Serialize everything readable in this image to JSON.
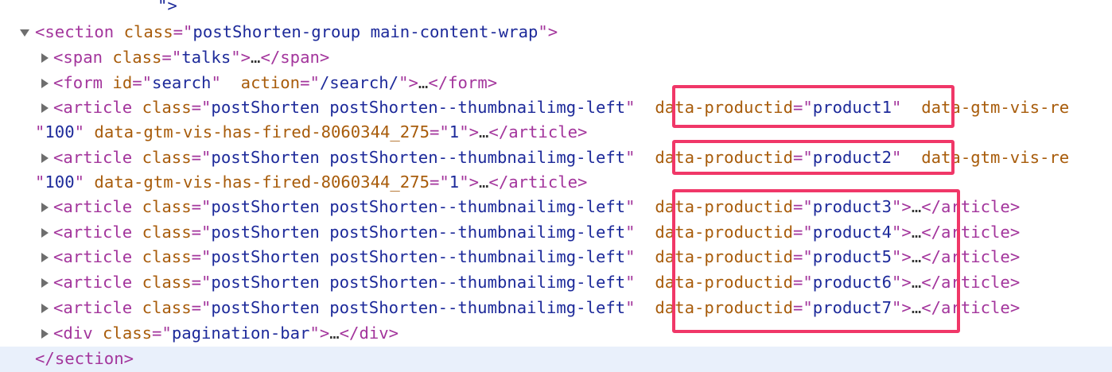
{
  "colors": {
    "tag": "#a3359c",
    "attribute": "#a85c0b",
    "value": "#1d2a9a",
    "highlight": "#f03768",
    "selected_row": "#e9f0fb"
  },
  "icons": {
    "expanded": "triangle-down-icon",
    "collapsed": "triangle-right-icon"
  },
  "tokens": {
    "lt": "<",
    "gt": ">",
    "lt_slash": "</",
    "eq": "=",
    "q": "\"",
    "ellipsis": "…"
  },
  "dom": {
    "top_fragment": "\">",
    "section": {
      "tag": "section",
      "class_attr": "class",
      "class_value": "postShorten-group main-content-wrap",
      "close": "section"
    },
    "span": {
      "tag": "span",
      "attr": "class",
      "value": "talks"
    },
    "form": {
      "tag": "form",
      "id_attr": "id",
      "id_value": "search",
      "action_attr": "action",
      "action_value": "/search/"
    },
    "article_tag": "article",
    "article_class_attr": "class",
    "article_class_value": "postShorten postShorten--thumbnailimg-left",
    "product_attr": "data-productid",
    "vis_attr_partial": "data-gtm-vis-re",
    "wrap_value": "100",
    "fired_attr": "data-gtm-vis-has-fired-8060344_275",
    "fired_value": "1",
    "articles": [
      {
        "productid": "product1"
      },
      {
        "productid": "product2"
      },
      {
        "productid": "product3"
      },
      {
        "productid": "product4"
      },
      {
        "productid": "product5"
      },
      {
        "productid": "product6"
      },
      {
        "productid": "product7"
      }
    ],
    "div": {
      "tag": "div",
      "attr": "class",
      "value": "pagination-bar"
    }
  }
}
